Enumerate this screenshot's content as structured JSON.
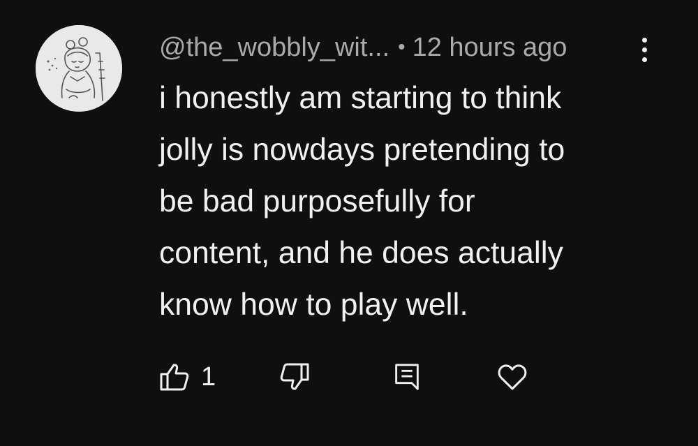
{
  "comment": {
    "author": "@the_wobbly_wit...",
    "separator": "•",
    "timestamp": "12 hours ago",
    "text_lines": [
      "i honestly am starting to think",
      "jolly is nowdays pretending to",
      "be bad purposefully for",
      "content, and he does actually",
      "know how to play well."
    ],
    "like_count": "1",
    "avatar": "user-avatar-sketch"
  },
  "icons": {
    "menu": "more-vert-icon",
    "like": "thumb-up-icon",
    "dislike": "thumb-down-icon",
    "reply": "reply-comment-icon",
    "heart": "heart-icon"
  },
  "colors": {
    "background": "#0f0f0f",
    "text": "#f1f1f1",
    "meta_text": "#aaaaaa"
  }
}
